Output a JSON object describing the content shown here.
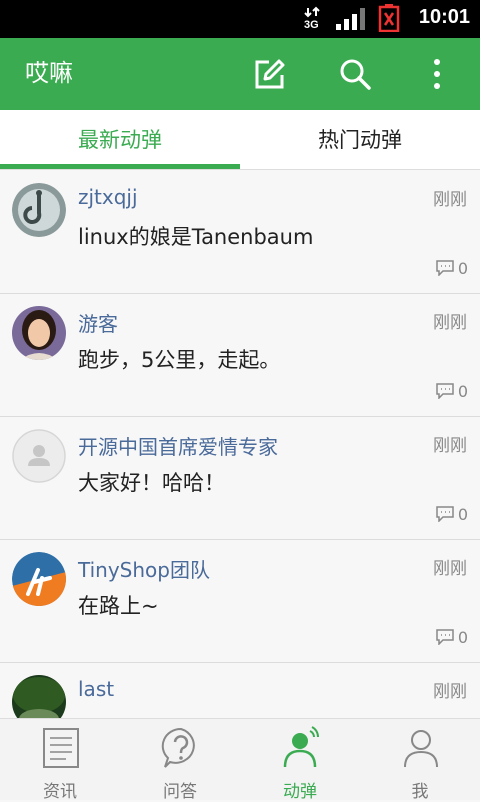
{
  "status_bar": {
    "time": "10:01",
    "network": "3G"
  },
  "app_bar": {
    "title": "哎嘛"
  },
  "tabs": [
    {
      "label": "最新动弹",
      "active": true
    },
    {
      "label": "热门动弹",
      "active": false
    }
  ],
  "feed": [
    {
      "name": "zjtxqjj",
      "time": "刚刚",
      "content": "linux的娘是Tanenbaum",
      "comments": "0",
      "avatar": "hook-logo-avatar"
    },
    {
      "name": "游客",
      "time": "刚刚",
      "content": "跑步，5公里，走起。",
      "comments": "0",
      "avatar": "photo-avatar"
    },
    {
      "name": "开源中国首席爱情专家",
      "time": "刚刚",
      "content": "大家好！哈哈！",
      "comments": "0",
      "avatar": "default-user-avatar"
    },
    {
      "name": "TinyShop团队",
      "time": "刚刚",
      "content": "在路上~",
      "comments": "0",
      "avatar": "tinyshop-logo-avatar"
    },
    {
      "name": "last",
      "time": "刚刚",
      "content": "",
      "comments": "",
      "avatar": "forest-photo-avatar"
    }
  ],
  "bottom_nav": [
    {
      "label": "资讯",
      "icon": "news-icon",
      "active": false
    },
    {
      "label": "问答",
      "icon": "question-icon",
      "active": false
    },
    {
      "label": "动弹",
      "icon": "tweet-icon",
      "active": true
    },
    {
      "label": "我",
      "icon": "profile-icon",
      "active": false
    }
  ],
  "colors": {
    "accent": "#3bab52",
    "username": "#4a6a9a"
  }
}
